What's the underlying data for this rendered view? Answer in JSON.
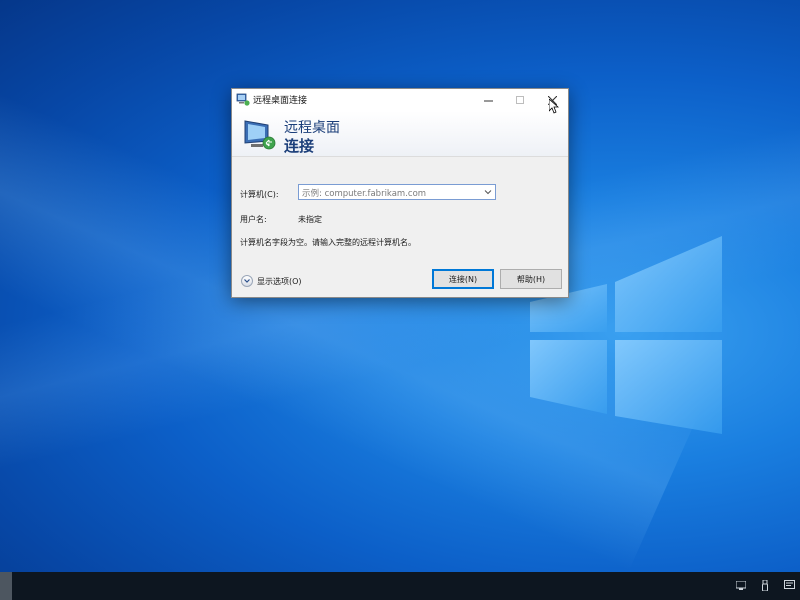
{
  "window": {
    "title": "远程桌面连接",
    "banner_line1": "远程桌面",
    "banner_line2": "连接"
  },
  "form": {
    "computer_label": "计算机(C):",
    "computer_placeholder": "示例: computer.fabrikam.com",
    "user_label": "用户名:",
    "user_value": "未指定",
    "hint": "计算机名字段为空。请输入完整的远程计算机名。"
  },
  "footer": {
    "show_options": "显示选项(O)",
    "connect_button": "连接(N)",
    "help_button": "帮助(H)"
  },
  "colors": {
    "accent": "#0078d7",
    "banner_text": "#1c3f7a",
    "desktop": "#0c5fc8",
    "taskbar": "#0d1620"
  },
  "icons": {
    "title": "remote-desktop-icon",
    "banner": "remote-desktop-icon",
    "minimize": "minimize-icon",
    "maximize": "maximize-icon",
    "close": "close-icon",
    "dropdown": "chevron-down-icon",
    "show_options": "chevron-down-circle-icon"
  }
}
